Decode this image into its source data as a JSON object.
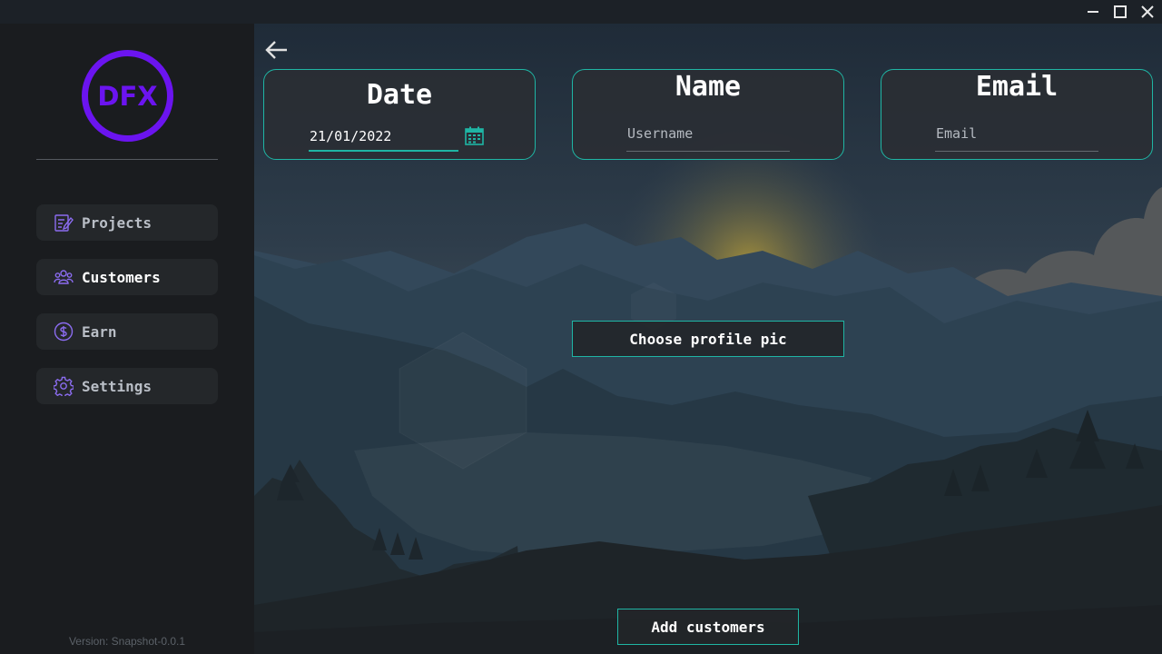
{
  "window": {
    "minimize_icon": "minimize-icon",
    "maximize_icon": "maximize-icon",
    "close_icon": "close-icon"
  },
  "sidebar": {
    "logo_text": "DFX",
    "items": [
      {
        "label": "Projects",
        "icon": "projects-icon"
      },
      {
        "label": "Customers",
        "icon": "customers-icon"
      },
      {
        "label": "Earn",
        "icon": "dollar-icon"
      },
      {
        "label": "Settings",
        "icon": "gear-icon"
      }
    ],
    "active_index": 1,
    "version": "Version: Snapshot-0.0.1"
  },
  "form": {
    "back_icon": "back-arrow-icon",
    "date": {
      "title": "Date",
      "value": "21/01/2022",
      "icon": "calendar-icon"
    },
    "name": {
      "title": "Name",
      "placeholder": "Username"
    },
    "email": {
      "title": "Email",
      "placeholder": "Email"
    },
    "profile_pic_button": "Choose profile pic",
    "submit_button": "Add customers"
  },
  "colors": {
    "accent": "#1fb5a4",
    "brand": "#6b14f0",
    "nav_icon": "#8b6cf0"
  }
}
